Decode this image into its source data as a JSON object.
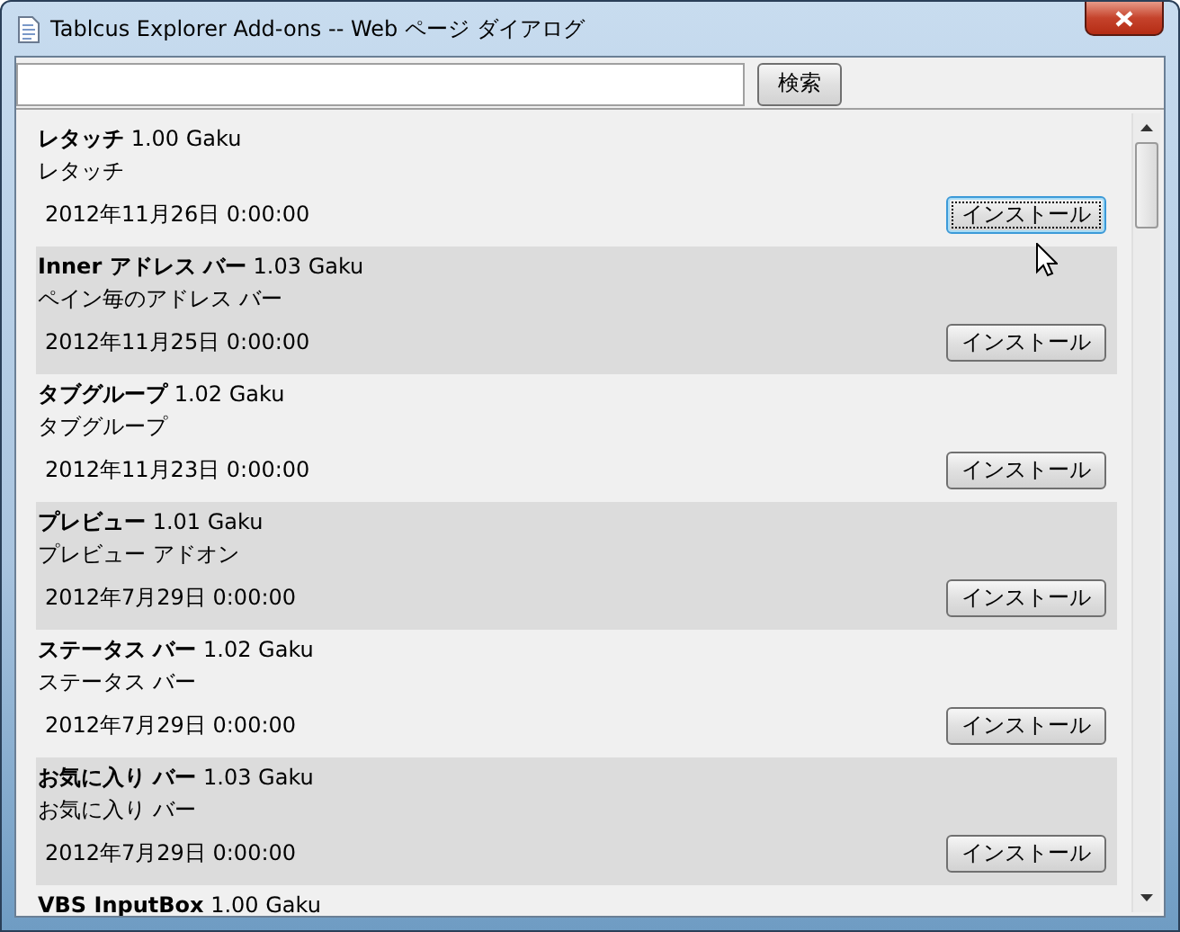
{
  "window": {
    "title": "Tablcus Explorer Add-ons -- Web ページ ダイアログ"
  },
  "search": {
    "button": "検索"
  },
  "addons": [
    {
      "name": "レタッチ",
      "version": "1.00 Gaku",
      "description": "レタッチ",
      "date": "2012年11月26日 0:00:00",
      "button": "インストール",
      "focused": true
    },
    {
      "name": "Inner アドレス バー",
      "version": "1.03 Gaku",
      "description": "ペイン毎のアドレス バー",
      "date": "2012年11月25日 0:00:00",
      "button": "インストール",
      "focused": false
    },
    {
      "name": "タブグループ",
      "version": "1.02 Gaku",
      "description": "タブグループ",
      "date": "2012年11月23日 0:00:00",
      "button": "インストール",
      "focused": false
    },
    {
      "name": "プレビュー",
      "version": "1.01 Gaku",
      "description": "プレビュー アドオン",
      "date": "2012年7月29日 0:00:00",
      "button": "インストール",
      "focused": false
    },
    {
      "name": "ステータス バー",
      "version": "1.02 Gaku",
      "description": "ステータス バー",
      "date": "2012年7月29日 0:00:00",
      "button": "インストール",
      "focused": false
    },
    {
      "name": "お気に入り バー",
      "version": "1.03 Gaku",
      "description": "お気に入り バー",
      "date": "2012年7月29日 0:00:00",
      "button": "インストール",
      "focused": false
    },
    {
      "name": "VBS InputBox",
      "version": "1.00 Gaku"
    }
  ]
}
